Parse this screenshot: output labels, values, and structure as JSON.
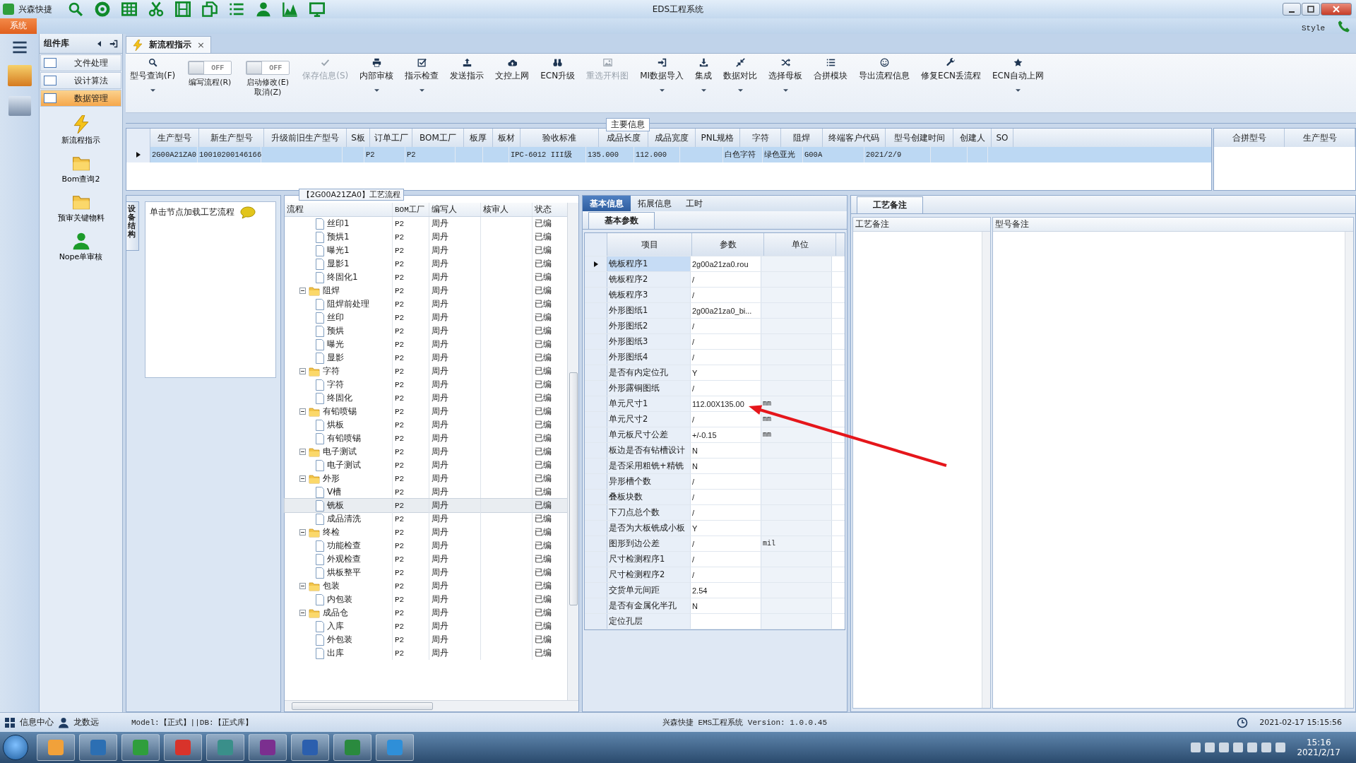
{
  "window": {
    "app_name": "兴森快捷",
    "title": "EDS工程系统",
    "style_label": "Style"
  },
  "ribbon_tabs": [
    {
      "label": "系统",
      "selected": true
    }
  ],
  "sidebar": {
    "title": "组件库",
    "items": [
      {
        "label": "文件处理",
        "selected": false
      },
      {
        "label": "设计算法",
        "selected": false
      },
      {
        "label": "数据管理",
        "selected": true
      }
    ],
    "tools": [
      {
        "label": "新流程指示"
      },
      {
        "label": "Bom查询2"
      },
      {
        "label": "预审关键物料"
      },
      {
        "label": "Nope单审核"
      }
    ]
  },
  "document_tab": {
    "label": "新流程指示",
    "close": "×"
  },
  "toolbar": [
    {
      "kind": "button",
      "label": "型号查询(F)",
      "disabled": false,
      "dropdown": true
    },
    {
      "kind": "toggle",
      "label": "编写流程(R)",
      "state_text": "OFF",
      "on": false
    },
    {
      "kind": "toggle",
      "label": "启动修改(E)",
      "sublabel": "取消(Z)",
      "state_text": "OFF",
      "on": false
    },
    {
      "kind": "button",
      "label": "保存信息(S)",
      "disabled": true,
      "dropdown": false
    },
    {
      "kind": "button",
      "label": "内部审核",
      "disabled": false,
      "dropdown": true
    },
    {
      "kind": "button",
      "label": "指示检查",
      "disabled": false,
      "dropdown": true
    },
    {
      "kind": "button",
      "label": "发送指示",
      "disabled": false,
      "dropdown": false
    },
    {
      "kind": "button",
      "label": "文控上网",
      "disabled": false,
      "dropdown": false
    },
    {
      "kind": "button",
      "label": "ECN升级",
      "disabled": false,
      "dropdown": false
    },
    {
      "kind": "button",
      "label": "重选开料图",
      "disabled": true,
      "dropdown": false
    },
    {
      "kind": "button",
      "label": "MI数据导入",
      "disabled": false,
      "dropdown": true
    },
    {
      "kind": "button",
      "label": "集成",
      "disabled": false,
      "dropdown": true
    },
    {
      "kind": "button",
      "label": "数据对比",
      "disabled": false,
      "dropdown": true
    },
    {
      "kind": "button",
      "label": "选择母板",
      "disabled": false,
      "dropdown": true
    },
    {
      "kind": "button",
      "label": "合拼模块",
      "disabled": false,
      "dropdown": false
    },
    {
      "kind": "button",
      "label": "导出流程信息",
      "disabled": false,
      "dropdown": false
    },
    {
      "kind": "button",
      "label": "修复ECN丢流程",
      "disabled": false,
      "dropdown": false
    },
    {
      "kind": "button",
      "label": "ECN自动上网",
      "disabled": false,
      "dropdown": true
    }
  ],
  "main_info": {
    "title": "主要信息",
    "columns": [
      "生产型号",
      "新生产型号",
      "升级前旧生产型号",
      "S板",
      "订单工厂",
      "BOM工厂",
      "板厚",
      "板材",
      "验收标准",
      "成品长度",
      "成品宽度",
      "PNL规格",
      "字符",
      "阻焊",
      "终端客户代码",
      "型号创建时间",
      "创建人",
      "SO"
    ],
    "rows": [
      {
        "selected": true,
        "cells": [
          "2G00A21ZA0",
          "10010200146166",
          null,
          null,
          "P2",
          "P2",
          null,
          null,
          "IPC-6012 III级",
          "135.000",
          "112.000",
          null,
          "白色字符",
          "绿色亚光",
          "G00A",
          "2021/2/9",
          null,
          null
        ]
      }
    ],
    "side_columns": [
      "合拼型号",
      "生产型号"
    ]
  },
  "process": {
    "side_tab": "设备结构",
    "hint": "单击节点加载工艺流程",
    "title": "【2G00A21ZA0】工艺流程",
    "columns": [
      "流程",
      "BOM工厂",
      "编写人",
      "核审人",
      "状态"
    ],
    "leaves": [
      {
        "name": "丝印1",
        "bom": "P2",
        "writer": "周丹",
        "status": "已编",
        "selected": false
      },
      {
        "name": "预烘1",
        "bom": "P2",
        "writer": "周丹",
        "status": "已编",
        "selected": false
      },
      {
        "name": "曝光1",
        "bom": "P2",
        "writer": "周丹",
        "status": "已编",
        "selected": false
      },
      {
        "name": "显影1",
        "bom": "P2",
        "writer": "周丹",
        "status": "已编",
        "selected": false
      },
      {
        "name": "终固化1",
        "bom": "P2",
        "writer": "周丹",
        "status": "已编",
        "selected": false
      }
    ],
    "groups": [
      {
        "name": "阻焊",
        "bom": "P2",
        "writer": "周丹",
        "status": "已编",
        "selected": false,
        "expanded": true,
        "children": [
          {
            "name": "阻焊前处理",
            "bom": "P2",
            "writer": "周丹",
            "status": "已编",
            "selected": false
          },
          {
            "name": "丝印",
            "bom": "P2",
            "writer": "周丹",
            "status": "已编",
            "selected": false
          },
          {
            "name": "预烘",
            "bom": "P2",
            "writer": "周丹",
            "status": "已编",
            "selected": false
          },
          {
            "name": "曝光",
            "bom": "P2",
            "writer": "周丹",
            "status": "已编",
            "selected": false
          },
          {
            "name": "显影",
            "bom": "P2",
            "writer": "周丹",
            "status": "已编",
            "selected": false
          }
        ]
      },
      {
        "name": "字符",
        "bom": "P2",
        "writer": "周丹",
        "status": "已编",
        "selected": false,
        "expanded": true,
        "children": [
          {
            "name": "字符",
            "bom": "P2",
            "writer": "周丹",
            "status": "已编",
            "selected": false
          },
          {
            "name": "终固化",
            "bom": "P2",
            "writer": "周丹",
            "status": "已编",
            "selected": false
          }
        ]
      },
      {
        "name": "有铅喷锡",
        "bom": "P2",
        "writer": "周丹",
        "status": "已编",
        "selected": false,
        "expanded": true,
        "children": [
          {
            "name": "烘板",
            "bom": "P2",
            "writer": "周丹",
            "status": "已编",
            "selected": false
          },
          {
            "name": "有铅喷锡",
            "bom": "P2",
            "writer": "周丹",
            "status": "已编",
            "selected": false
          }
        ]
      },
      {
        "name": "电子测试",
        "bom": "P2",
        "writer": "周丹",
        "status": "已编",
        "selected": false,
        "expanded": true,
        "children": [
          {
            "name": "电子测试",
            "bom": "P2",
            "writer": "周丹",
            "status": "已编",
            "selected": false
          }
        ]
      },
      {
        "name": "外形",
        "bom": "P2",
        "writer": "周丹",
        "status": "已编",
        "selected": false,
        "expanded": true,
        "children": [
          {
            "name": "V槽",
            "bom": "P2",
            "writer": "周丹",
            "status": "已编",
            "selected": false
          },
          {
            "name": "铣板",
            "bom": "P2",
            "writer": "周丹",
            "status": "已编",
            "selected": true
          },
          {
            "name": "成品清洗",
            "bom": "P2",
            "writer": "周丹",
            "status": "已编",
            "selected": false
          }
        ]
      },
      {
        "name": "终检",
        "bom": "P2",
        "writer": "周丹",
        "status": "已编",
        "selected": false,
        "expanded": true,
        "children": [
          {
            "name": "功能检查",
            "bom": "P2",
            "writer": "周丹",
            "status": "已编",
            "selected": false
          },
          {
            "name": "外观检查",
            "bom": "P2",
            "writer": "周丹",
            "status": "已编",
            "selected": false
          },
          {
            "name": "烘板整平",
            "bom": "P2",
            "writer": "周丹",
            "status": "已编",
            "selected": false
          }
        ]
      },
      {
        "name": "包装",
        "bom": "P2",
        "writer": "周丹",
        "status": "已编",
        "selected": false,
        "expanded": true,
        "children": [
          {
            "name": "内包装",
            "bom": "P2",
            "writer": "周丹",
            "status": "已编",
            "selected": false
          }
        ]
      },
      {
        "name": "成品仓",
        "bom": "P2",
        "writer": "周丹",
        "status": "已编",
        "selected": false,
        "expanded": true,
        "children": [
          {
            "name": "入库",
            "bom": "P2",
            "writer": "周丹",
            "status": "已编",
            "selected": false
          },
          {
            "name": "外包装",
            "bom": "P2",
            "writer": "周丹",
            "status": "已编",
            "selected": false
          },
          {
            "name": "出库",
            "bom": "P2",
            "writer": "周丹",
            "status": "已编",
            "selected": false
          }
        ]
      }
    ]
  },
  "details": {
    "tabs": [
      {
        "label": "基本信息",
        "selected": true
      },
      {
        "label": "拓展信息",
        "selected": false
      },
      {
        "label": "工时",
        "selected": false
      }
    ],
    "section": "基本参数",
    "columns": [
      "项目",
      "参数",
      "单位"
    ],
    "rows": [
      {
        "name": "铣板程序1",
        "value": "2g00a21za0.rou",
        "selected": true
      },
      {
        "name": "铣板程序2",
        "value": "/",
        "selected": false
      },
      {
        "name": "铣板程序3",
        "value": "/",
        "selected": false
      },
      {
        "name": "外形图纸1",
        "value": "2g00a21za0_bi...",
        "selected": false
      },
      {
        "name": "外形图纸2",
        "value": "/",
        "selected": false
      },
      {
        "name": "外形图纸3",
        "value": "/",
        "selected": false
      },
      {
        "name": "外形图纸4",
        "value": "/",
        "selected": false
      },
      {
        "name": "是否有内定位孔",
        "value": "Y",
        "selected": false
      },
      {
        "name": "外形露铜图纸",
        "value": "/",
        "selected": false
      },
      {
        "name": "单元尺寸1",
        "value": "112.00X135.00",
        "unit": "mm",
        "selected": false
      },
      {
        "name": "单元尺寸2",
        "value": "/",
        "unit": "mm",
        "selected": false
      },
      {
        "name": "单元板尺寸公差",
        "value": "+/-0.15",
        "unit": "mm",
        "selected": false
      },
      {
        "name": "板边是否有钻槽设计",
        "value": "N",
        "selected": false
      },
      {
        "name": "是否采用粗铣+精铣",
        "value": "N",
        "selected": false
      },
      {
        "name": "异形槽个数",
        "value": "/",
        "selected": false
      },
      {
        "name": "叠板块数",
        "value": "/",
        "selected": false
      },
      {
        "name": "下刀点总个数",
        "value": "/",
        "selected": false
      },
      {
        "name": "是否为大板铣成小板",
        "value": "Y",
        "selected": false
      },
      {
        "name": "图形到边公差",
        "value": "/",
        "unit": "mil",
        "selected": false
      },
      {
        "name": "尺寸检测程序1",
        "value": "/",
        "selected": false
      },
      {
        "name": "尺寸检测程序2",
        "value": "/",
        "selected": false
      },
      {
        "name": "交货单元间距",
        "value": "2.54",
        "selected": false
      },
      {
        "name": "是否有金属化半孔",
        "value": "N",
        "selected": false
      },
      {
        "name": "定位孔层",
        "selected": false
      }
    ]
  },
  "notes": {
    "tab": "工艺备注",
    "columns": [
      "工艺备注",
      "型号备注"
    ]
  },
  "status_bar": {
    "info": "信息中心",
    "user": "龙数远",
    "model": "Model:【正式】||DB:【正式库】",
    "product": "兴森快捷 EMS工程系统 Version: 1.0.0.45",
    "datetime": "2021-02-17 15:15:56"
  },
  "taskbar": {
    "time": "15:16",
    "date": "2021/2/17"
  }
}
